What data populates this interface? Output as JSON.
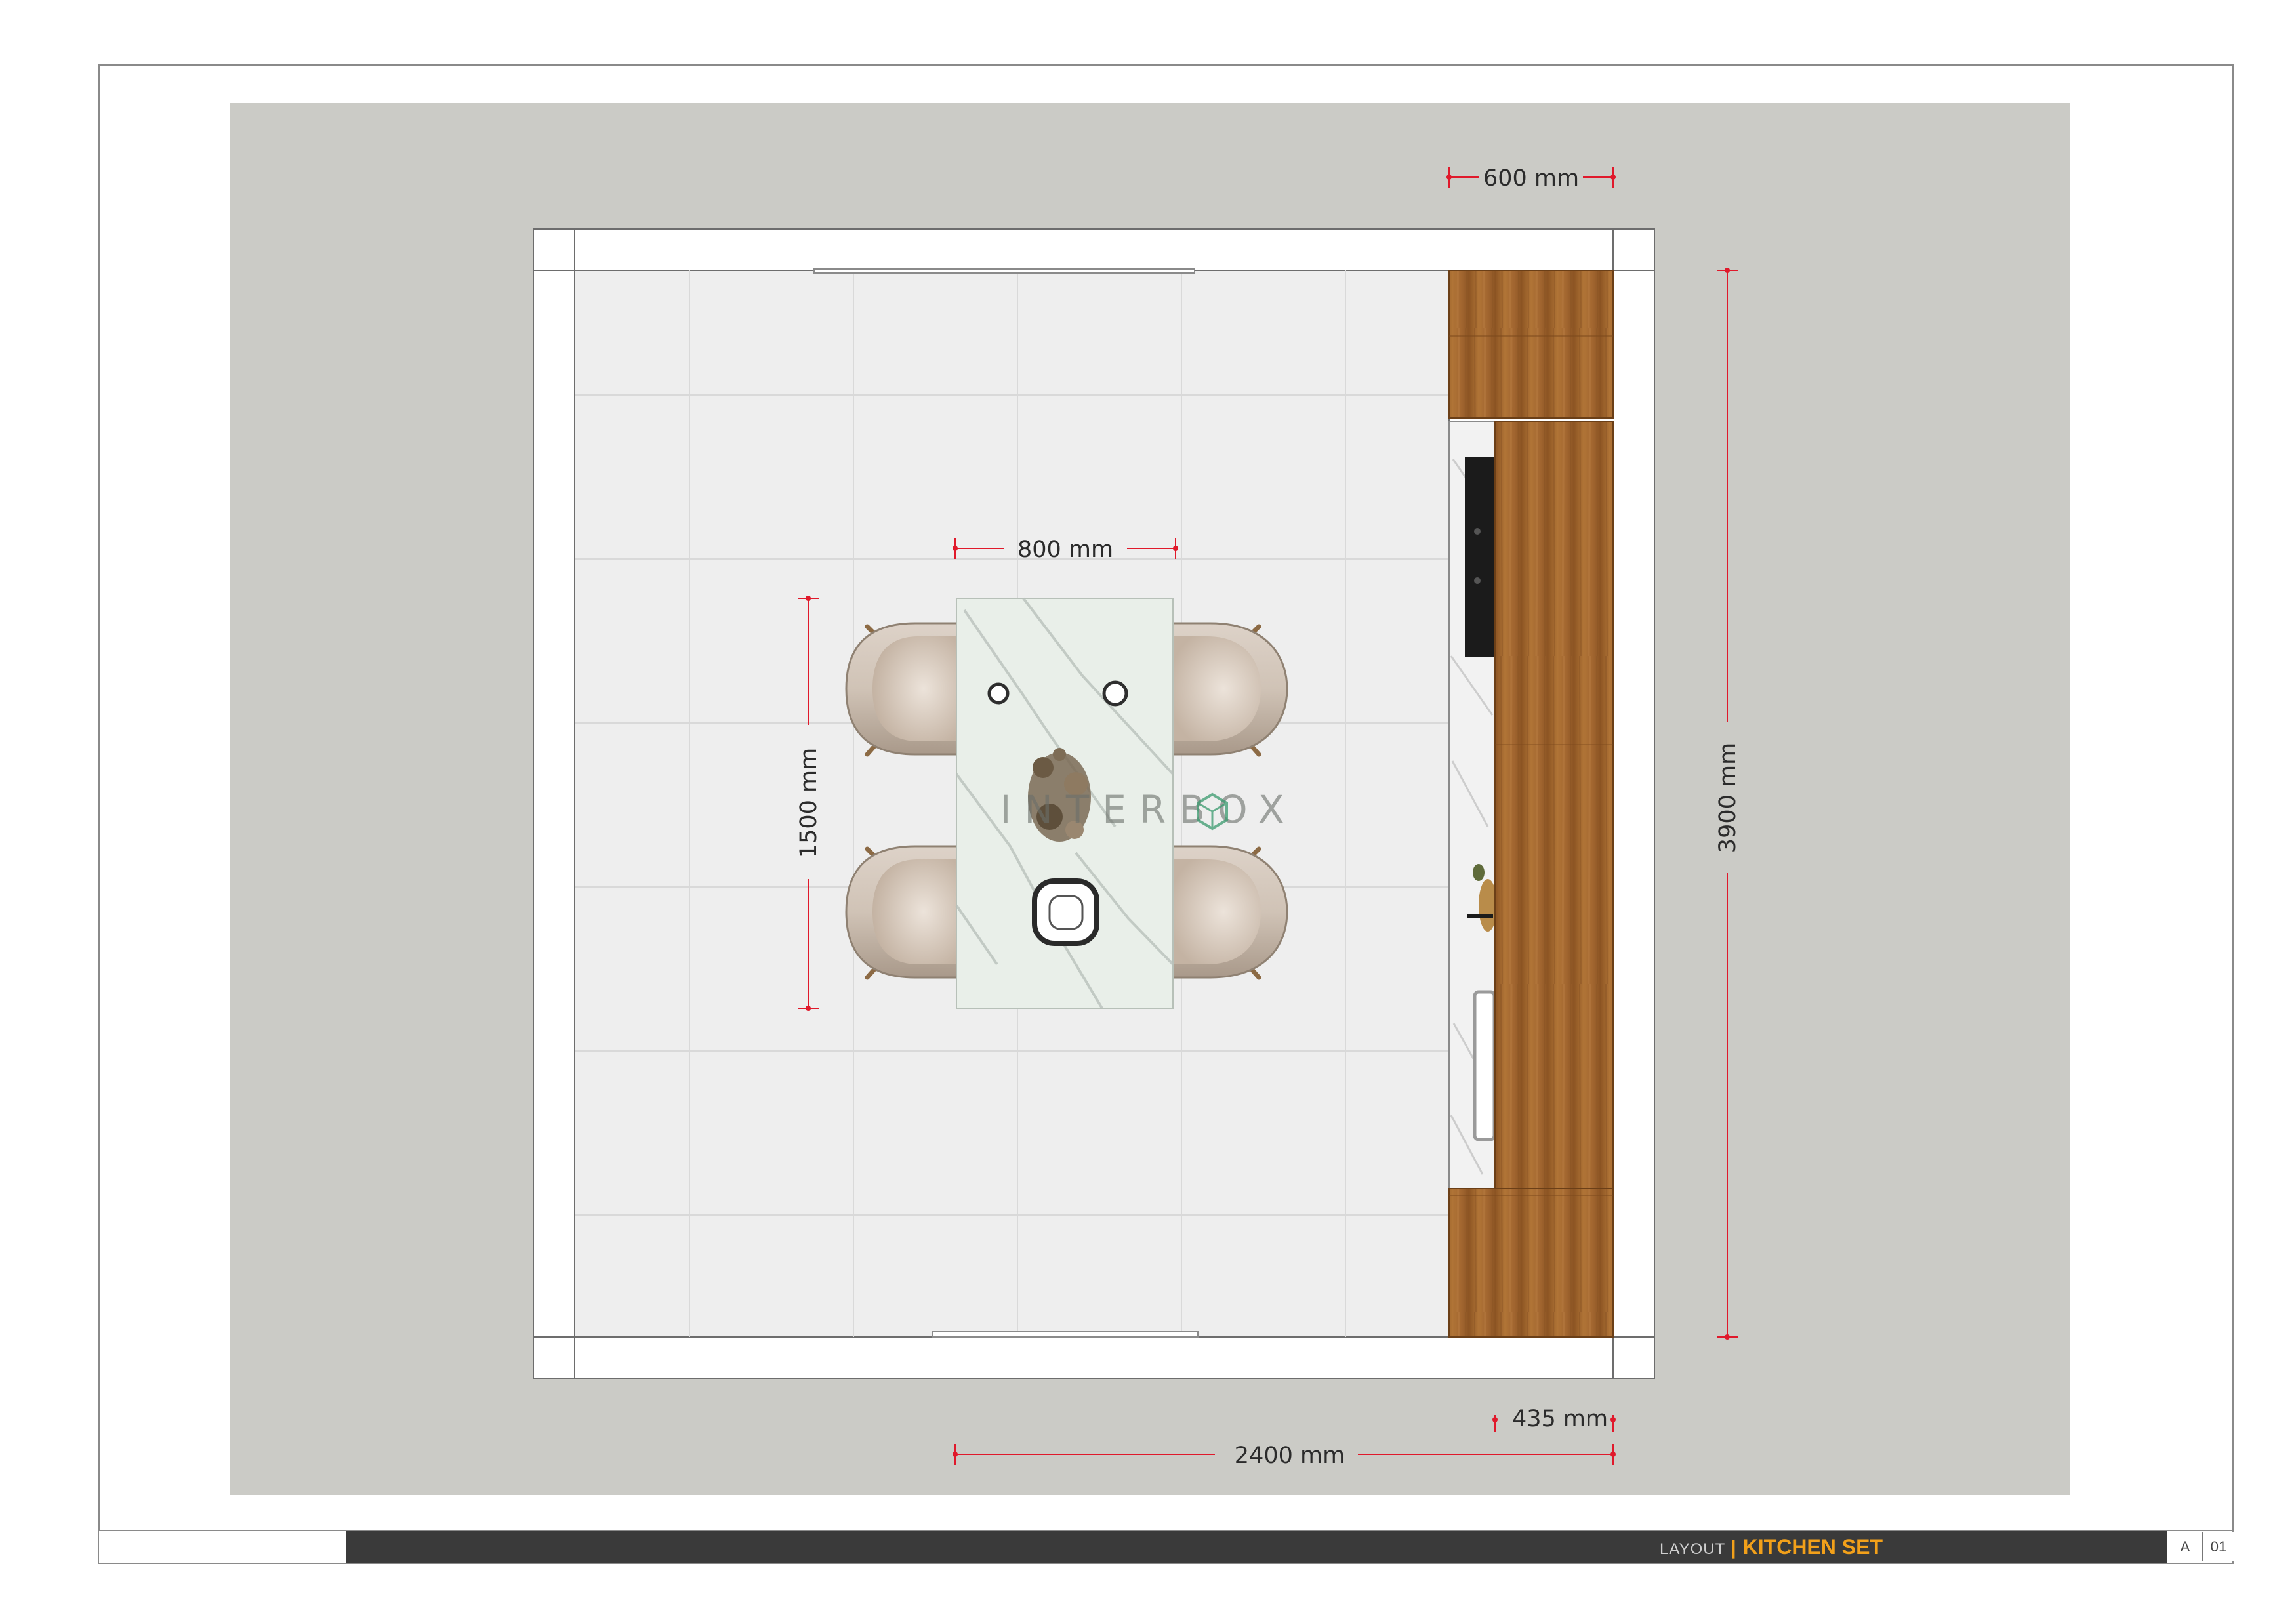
{
  "drawing": {
    "title_label": "LAYOUT",
    "title_separator": "|",
    "title_name": "KITCHEN SET",
    "sheet_letter": "A",
    "sheet_number": "01",
    "watermark": "INTERBOX"
  },
  "dimensions": {
    "cabinet_depth": "600 mm",
    "table_width": "800 mm",
    "table_length": "1500 mm",
    "room_length": "3900 mm",
    "room_width": "2400 mm",
    "counter_depth": "435 mm"
  },
  "colors": {
    "background_panel": "#cbcbc6",
    "wall": "#ffffff",
    "floor": "#eeeeee",
    "wood": "#a86c32",
    "dimension_line": "#e0192b",
    "title_accent": "#f2a01a",
    "title_bar": "#3a3a3a"
  }
}
